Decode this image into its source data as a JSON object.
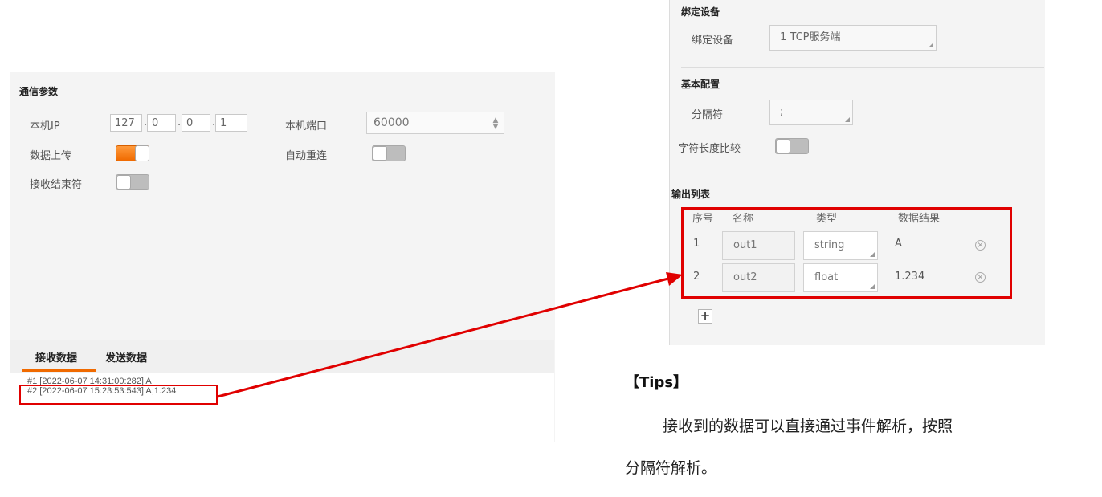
{
  "comm": {
    "title": "通信参数",
    "local_ip_label": "本机IP",
    "ip": [
      "127",
      "0",
      "0",
      "1"
    ],
    "local_port_label": "本机端口",
    "local_port_value": "60000",
    "data_upload_label": "数据上传",
    "data_upload_on": true,
    "auto_reconnect_label": "自动重连",
    "auto_reconnect_on": false,
    "recv_terminator_label": "接收结束符",
    "recv_terminator_on": false
  },
  "log": {
    "tab_receive": "接收数据",
    "tab_send": "发送数据",
    "lines": [
      "#1 [2022-06-07  14:31:00:282] A",
      "#2 [2022-06-07  15:23:53:543] A;1.234"
    ]
  },
  "binding": {
    "title": "绑定设备",
    "device_label": "绑定设备",
    "device_value": "1 TCP服务端"
  },
  "basic": {
    "title": "基本配置",
    "separator_label": "分隔符",
    "separator_value": ";",
    "char_len_label": "字符长度比较",
    "char_len_on": false
  },
  "output": {
    "title": "输出列表",
    "headers": [
      "序号",
      "名称",
      "类型",
      "数据结果"
    ],
    "rows": [
      {
        "index": "1",
        "name": "out1",
        "type": "string",
        "result": "A"
      },
      {
        "index": "2",
        "name": "out2",
        "type": "float",
        "result": "1.234"
      }
    ]
  },
  "tips": {
    "title": "【Tips】",
    "line1": "接收到的数据可以直接通过事件解析，按照",
    "line2": "分隔符解析。"
  },
  "colors": {
    "accent_orange": "#f06a00",
    "highlight_red": "#e00000"
  }
}
